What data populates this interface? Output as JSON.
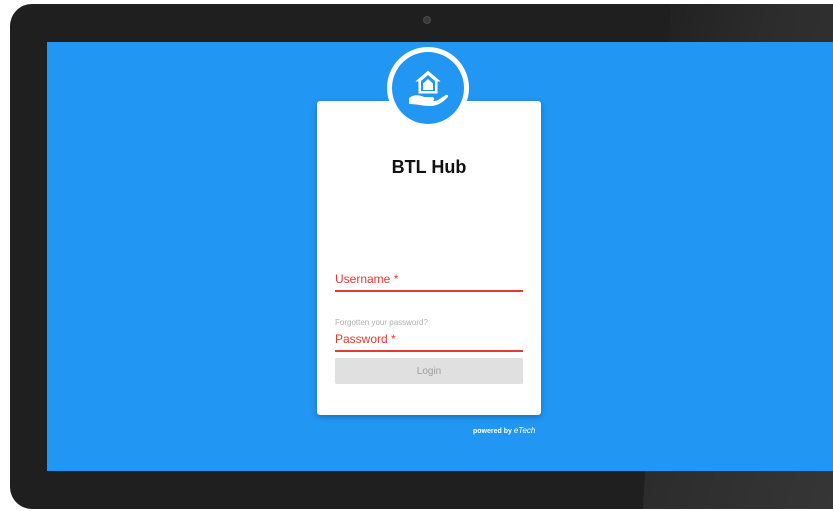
{
  "app": {
    "title": "BTL Hub",
    "logo_icon": "house-in-hand-icon"
  },
  "login_form": {
    "username_label": "Username *",
    "password_label": "Password *",
    "forgot_link": "Forgotten your password?",
    "login_button": "Login"
  },
  "footer": {
    "powered_prefix": "powered by",
    "brand": "eTech"
  },
  "colors": {
    "screen_bg": "#2196f3",
    "error_accent": "#e53935",
    "device_bezel": "#1f1f1f"
  }
}
